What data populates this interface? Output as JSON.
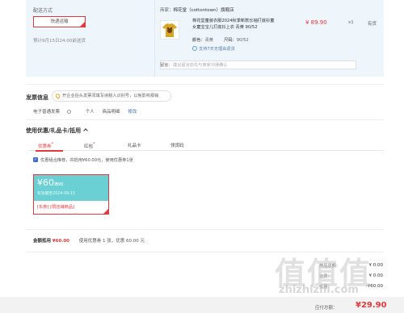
{
  "shipping": {
    "label": "配送方式",
    "option": "快递运输",
    "arrival": "预计9月15日24:00前送货"
  },
  "seller": {
    "prefix": "商家：",
    "name": "棉花堂（cottontown）旗舰店"
  },
  "product": {
    "title": "棉花堂童装衣服2024秋季新款长袖打底衫童女童宝宝儿打底衫上衣 青黄 90/52",
    "color_label": "颜色：",
    "color_value": "青黄",
    "size_label": "尺码：",
    "size_value": "90/52",
    "refund": "支持7天无理由退货",
    "price": "¥ 89.90",
    "qty": "x1",
    "stock": "有货"
  },
  "message": {
    "label": "留言：",
    "placeholder": "建议留言前先与商家沟通确认"
  },
  "invoice": {
    "title": "发票信息",
    "tip": "开企业抬头发票须填写纳税人识别号，以免影响报销",
    "type": "电子普通发票",
    "person": "个人",
    "detail": "商品明细",
    "modify": "修改"
  },
  "coupons": {
    "title": "使用优惠/礼品卡/抵用",
    "tabs": [
      {
        "label": "优惠券",
        "mark": "*"
      },
      {
        "label": "红包",
        "mark": "*"
      },
      {
        "label": "礼品卡",
        "mark": ""
      },
      {
        "label": "领货码",
        "mark": ""
      }
    ],
    "combo_label": "优惠组合推荐，共抵用¥60.00元，使用优惠券1张",
    "card": {
      "amount": "¥60",
      "amount_suffix": "满99",
      "date": "有效期至2024-09-15",
      "link1": "[东券]",
      "link2": "[限店铺商品]"
    },
    "summary_label": "金额抵用",
    "summary_amount": "¥60.00",
    "summary_text": "使用优惠券 1 张，优惠 60.00 元"
  },
  "totals": [
    {
      "label": "商品总额：",
      "value": "¥ 0.00"
    },
    {
      "label": "运费：",
      "value": "¥ 0.00"
    },
    {
      "label": "优惠：",
      "value": "-¥60.00"
    }
  ],
  "pay": {
    "label": "应付总额：",
    "value": "¥29.90"
  },
  "watermark": {
    "big": "值值值",
    "small": "zhizhizhi.com"
  },
  "colors": {
    "accent": "#e4393c",
    "coupon": "#6bd0d3",
    "link": "#3a6fb0"
  }
}
